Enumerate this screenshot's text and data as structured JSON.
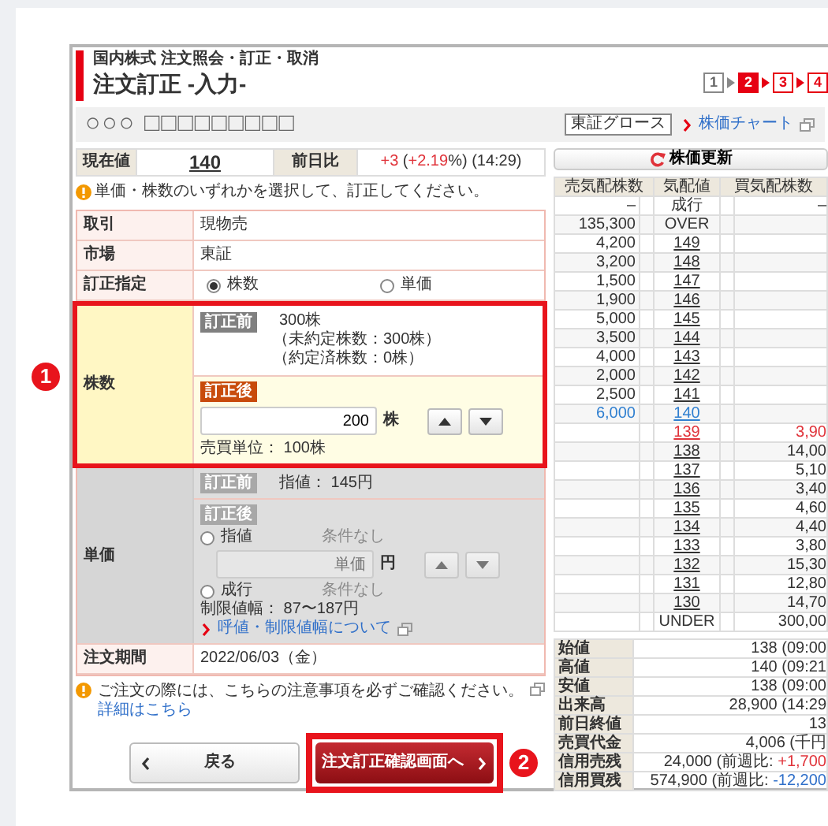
{
  "breadcrumb": "国内株式 注文照会・訂正・取消",
  "title": "注文訂正 -入力-",
  "steps": [
    {
      "label": "1",
      "selected": false
    },
    {
      "label": "2",
      "selected": true
    },
    {
      "label": "3",
      "selected": false
    },
    {
      "label": "4",
      "selected": false
    }
  ],
  "stock": {
    "name": "○○○ □□□□□□□□□",
    "market": "東証グロース",
    "chart_link": "株価チャート"
  },
  "quote": {
    "price_label": "現在値",
    "price": "140",
    "change_label": "前日比",
    "change": [
      {
        "text": "+3",
        "color": "#e0333a"
      },
      {
        "text": " ("
      },
      {
        "text": "+2.19",
        "color": "#e0333a"
      },
      {
        "text": "%) (14:29)"
      }
    ]
  },
  "notice": "単価・株数のいずれかを選択して、訂正してください。",
  "form": {
    "trade": {
      "label": "取引",
      "value": "現物売"
    },
    "market": {
      "label": "市場",
      "value": "東証"
    },
    "target": {
      "label": "訂正指定",
      "options": [
        {
          "label": "株数",
          "selected": true
        },
        {
          "label": "単価",
          "selected": false
        }
      ]
    },
    "shares": {
      "label": "株数",
      "callout": "1",
      "before_badge": "訂正前",
      "before_lines": [
        "300株",
        "（未約定株数：300株）",
        "（約定済株数：0株）"
      ],
      "after_badge": "訂正後",
      "value": "200",
      "unit": "株",
      "lot": "売買単位： 100株"
    },
    "price": {
      "label": "単価",
      "disabled": true,
      "before_badge": "訂正前",
      "before_text": "指値： 145円",
      "after_badge": "訂正後",
      "options": [
        {
          "label": "指値",
          "selected": false,
          "condition": "条件なし"
        },
        {
          "label": "成行",
          "selected": false,
          "condition": "条件なし"
        }
      ],
      "placeholder": "単価",
      "unit": "円",
      "range": "制限値幅： 87〜187円",
      "link": "呼値・制限値幅について"
    },
    "period": {
      "label": "注文期間",
      "value": "2022/06/03（金）"
    }
  },
  "caution": {
    "text": "ご注文の際には、こちらの注意事項を必ずご確認ください。",
    "link": "詳細はこちら"
  },
  "buttons": {
    "back": "戻る",
    "confirm": "注文訂正確認画面へ",
    "callout": "2"
  },
  "refresh": "株価更新",
  "order_book": {
    "columns": [
      "売気配株数",
      "気配値",
      "買気配株数"
    ],
    "rows": [
      {
        "kind": "label",
        "sell": "–",
        "price": "成行",
        "buy": "–"
      },
      {
        "kind": "label",
        "sell": "135,300",
        "price": "OVER"
      },
      {
        "kind": "price",
        "sell": "4,200",
        "price": "149"
      },
      {
        "kind": "price",
        "sell": "3,200",
        "price": "148"
      },
      {
        "kind": "price",
        "sell": "1,500",
        "price": "147"
      },
      {
        "kind": "price",
        "sell": "1,900",
        "price": "146"
      },
      {
        "kind": "price",
        "sell": "5,000",
        "price": "145"
      },
      {
        "kind": "price",
        "sell": "3,500",
        "price": "144"
      },
      {
        "kind": "price",
        "sell": "4,000",
        "price": "143"
      },
      {
        "kind": "price",
        "sell": "2,000",
        "price": "142"
      },
      {
        "kind": "price",
        "sell": "2,500",
        "price": "141"
      },
      {
        "kind": "price",
        "sell": "6,000",
        "price": "140",
        "color": "#2f7fd0"
      },
      {
        "kind": "price",
        "price": "139",
        "buy": "3,90",
        "color": "#e0333a"
      },
      {
        "kind": "price",
        "price": "138",
        "buy": "14,00"
      },
      {
        "kind": "price",
        "price": "137",
        "buy": "5,10"
      },
      {
        "kind": "price",
        "price": "136",
        "buy": "3,40"
      },
      {
        "kind": "price",
        "price": "135",
        "buy": "4,60"
      },
      {
        "kind": "price",
        "price": "134",
        "buy": "4,40"
      },
      {
        "kind": "price",
        "price": "133",
        "buy": "3,80"
      },
      {
        "kind": "price",
        "price": "132",
        "buy": "15,30"
      },
      {
        "kind": "price",
        "price": "131",
        "buy": "12,80"
      },
      {
        "kind": "price",
        "price": "130",
        "buy": "14,70"
      },
      {
        "kind": "label",
        "price": "UNDER",
        "buy": "300,00"
      }
    ]
  },
  "stats": [
    {
      "label": "始値",
      "value": [
        {
          "text": "138 (09:00"
        }
      ]
    },
    {
      "label": "高値",
      "value": [
        {
          "text": "140 (09:21"
        }
      ]
    },
    {
      "label": "安値",
      "value": [
        {
          "text": "138 (09:00"
        }
      ]
    },
    {
      "label": "出来高",
      "value": [
        {
          "text": "28,900 (14:29"
        }
      ]
    },
    {
      "label": "前日終値",
      "value": [
        {
          "text": "13"
        }
      ]
    },
    {
      "label": "売買代金",
      "value": [
        {
          "text": "4,006 (千円"
        }
      ]
    },
    {
      "label": "信用売残",
      "value": [
        {
          "text": "24,000 (前週比: "
        },
        {
          "text": "+1,700",
          "color": "#e0333a"
        }
      ]
    },
    {
      "label": "信用買残",
      "value": [
        {
          "text": "574,900 (前週比: "
        },
        {
          "text": "-12,200",
          "color": "#2f6fc9"
        }
      ]
    }
  ]
}
